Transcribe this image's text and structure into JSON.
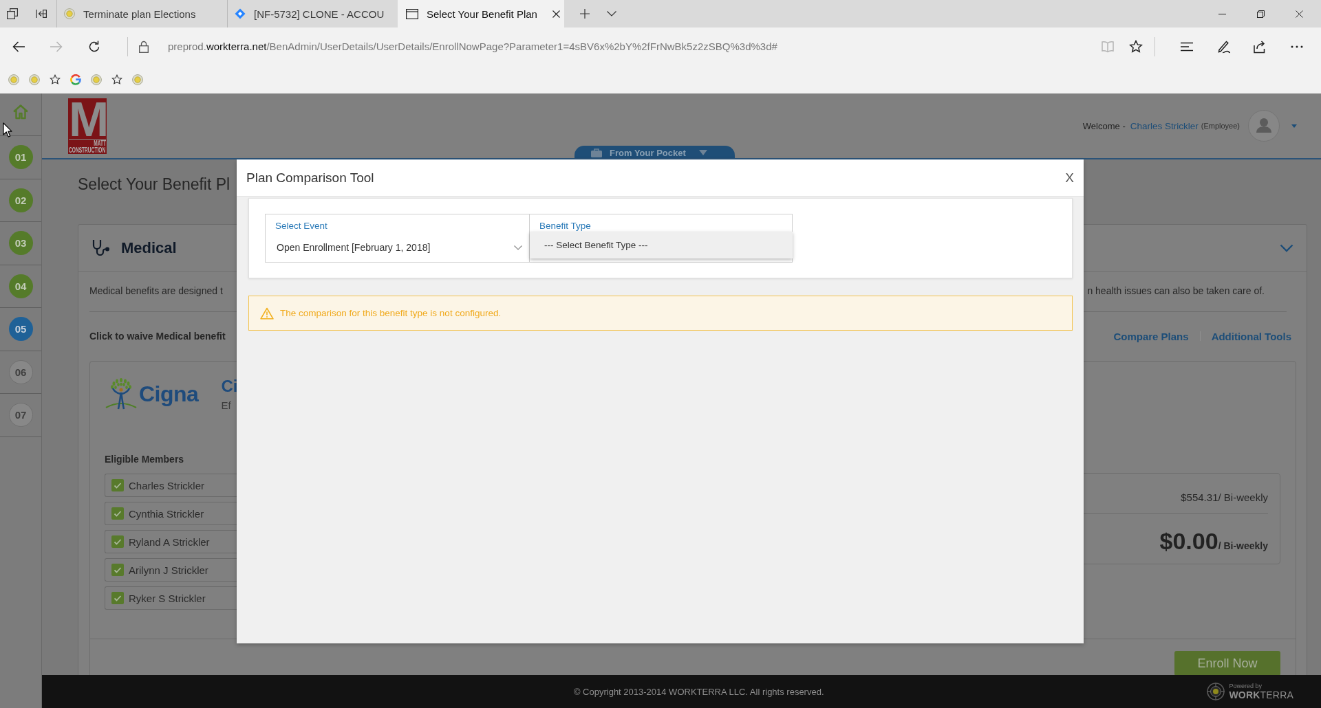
{
  "browser": {
    "tabs": [
      {
        "title": "Terminate plan Elections",
        "kind": "seal",
        "selected": false
      },
      {
        "title": "[NF-5732] CLONE - ACCOU",
        "kind": "diamond",
        "selected": false
      },
      {
        "title": "Select Your Benefit Plan",
        "kind": "page",
        "selected": true
      }
    ],
    "nav": [
      {
        "kind": "back",
        "disabled": false
      },
      {
        "kind": "forward",
        "disabled": true
      },
      {
        "kind": "refresh",
        "disabled": false
      }
    ],
    "address": {
      "subdomain": "preprod.",
      "domain": "workterra.net",
      "path": "/BenAdmin/UserDetails/UserDetails/EnrollNowPage?Parameter1=4sBV6x%2bY%2fFrNwBk5z2zSBQ%3d%3d#"
    },
    "tools": [
      {
        "kind": "reading",
        "disabled": true
      },
      {
        "kind": "favorite",
        "disabled": false
      },
      {
        "kind": "hub",
        "disabled": false
      },
      {
        "kind": "notes",
        "disabled": false
      },
      {
        "kind": "share",
        "disabled": false
      },
      {
        "kind": "more",
        "disabled": false
      }
    ],
    "favorites": [
      {
        "kind": "seal"
      },
      {
        "kind": "seal"
      },
      {
        "kind": "star"
      },
      {
        "kind": "g"
      },
      {
        "kind": "seal"
      },
      {
        "kind": "star"
      },
      {
        "kind": "seal"
      }
    ]
  },
  "sidebar": {
    "steps": [
      {
        "label": "01",
        "completed": true,
        "selected": false
      },
      {
        "label": "02",
        "completed": true,
        "selected": false
      },
      {
        "label": "03",
        "completed": true,
        "selected": false
      },
      {
        "label": "04",
        "completed": true,
        "selected": false
      },
      {
        "label": "05",
        "completed": true,
        "selected": true
      },
      {
        "label": "06",
        "completed": false,
        "selected": false
      },
      {
        "label": "07",
        "completed": false,
        "selected": false
      }
    ]
  },
  "header": {
    "logo": {
      "letter": "M",
      "line_1": "MATT",
      "line_2": "CONSTRUCTION"
    },
    "pocket_button": "From Your Pocket",
    "welcome": "Welcome -",
    "user_name": "Charles Strickler",
    "role": "(Employee)"
  },
  "page_title": "Select Your Benefit Pl",
  "benefit_card": {
    "title": "Medical",
    "description_start": "Medical benefits are designed t",
    "description_end": "n health issues can also be taken care of.",
    "waive_link": "Click to waive Medical benefit",
    "links": [
      "Compare Plans",
      "Additional Tools"
    ],
    "plan": {
      "carrier": "Cigna",
      "name": "Ci",
      "effective": "Ef",
      "members_heading": "Eligible Members",
      "members": [
        {
          "name": "Charles Strickler",
          "checked": true
        },
        {
          "name": "Cynthia Strickler",
          "checked": true
        },
        {
          "name": "Ryland A Strickler",
          "checked": true
        },
        {
          "name": "Arilynn J Strickler",
          "checked": true
        },
        {
          "name": "Ryker S Strickler",
          "checked": true
        }
      ],
      "full_cost": "$554.31/ Bi-weekly",
      "your_cost": "$0.00",
      "your_cost_period": "/ Bi-weekly"
    },
    "enroll_button": "Enroll Now"
  },
  "modal": {
    "title": "Plan Comparison Tool",
    "close_label": "X",
    "event_select": {
      "label": "Select Event",
      "value": "Open Enrollment [February 1, 2018]"
    },
    "benefit_type": {
      "label": "Benefit Type",
      "expanded": true,
      "options": [
        {
          "label": "--- Select Benefit Type ---",
          "selected": true
        }
      ]
    },
    "alert": "The comparison for this benefit type is not configured."
  },
  "footer": {
    "copyright": "© Copyright 2013-2014 WORKTERRA LLC. All rights reserved.",
    "powered_by": "Powered by",
    "brand": "**WORK**TERRA"
  }
}
